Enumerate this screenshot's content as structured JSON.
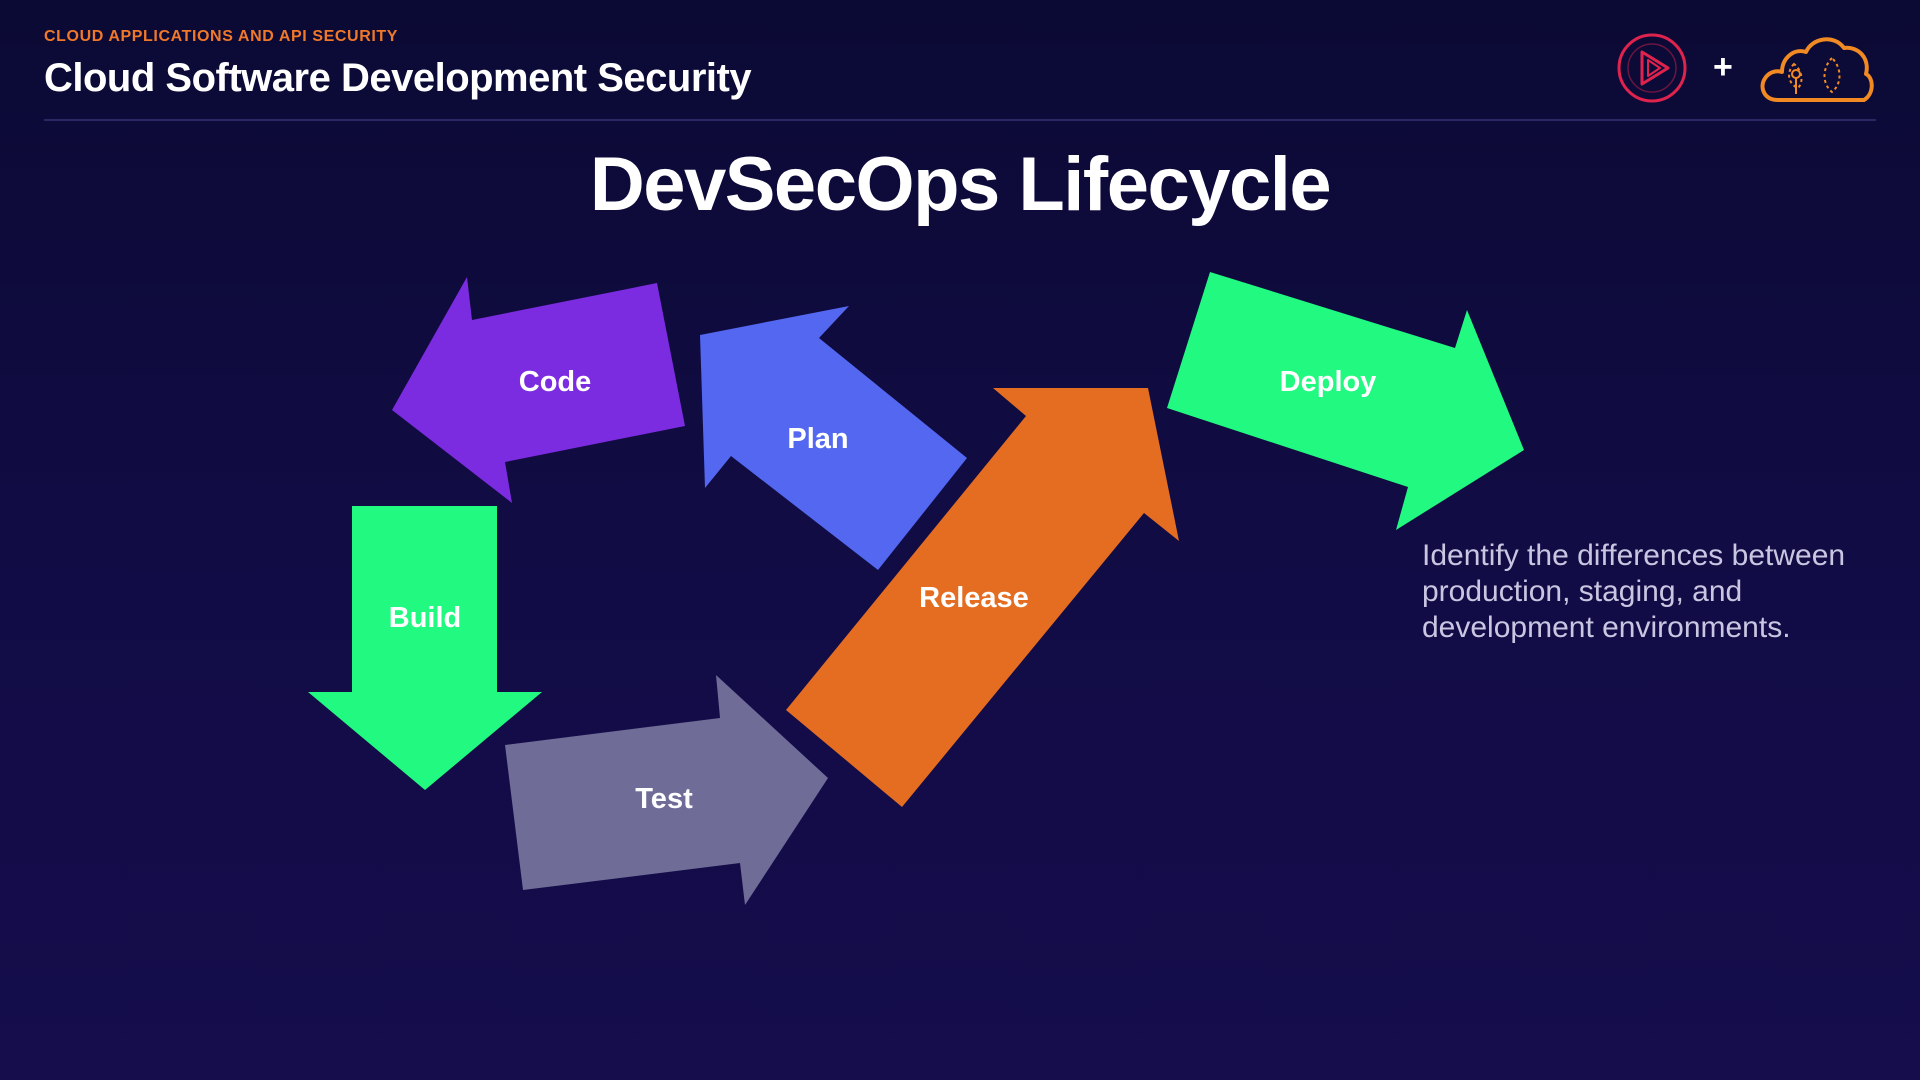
{
  "header": {
    "eyebrow": "CLOUD APPLICATIONS AND API SECURITY",
    "course_title": "Cloud Software Development Security",
    "plus": "+"
  },
  "slide": {
    "title": "DevSecOps Lifecycle",
    "note": "Identify the differences between production, staging, and development environments."
  },
  "lifecycle": {
    "code": {
      "label": "Code",
      "color": "#7b2be0"
    },
    "plan": {
      "label": "Plan",
      "color": "#5367f0"
    },
    "build": {
      "label": "Build",
      "color": "#22f981"
    },
    "test": {
      "label": "Test",
      "color": "#6f6c97"
    },
    "release": {
      "label": "Release",
      "color": "#e56d22"
    },
    "deploy": {
      "label": "Deploy",
      "color": "#22f981"
    }
  },
  "brand": {
    "play_icon_color": "#e0234e",
    "cloud_icon_color": "#f28a24"
  }
}
